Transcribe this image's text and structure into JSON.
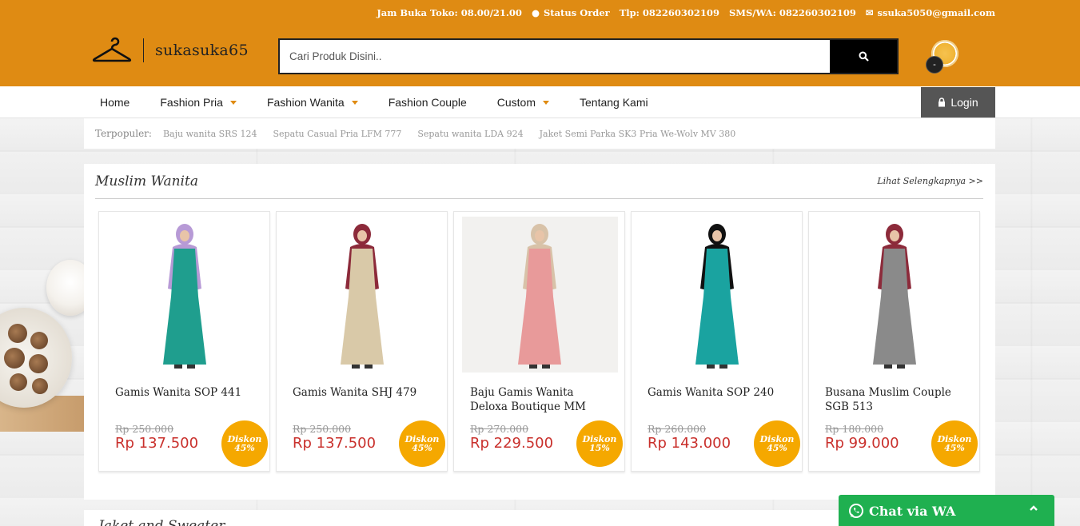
{
  "topbar": {
    "hours": "Jam Buka Toko: 08.00/21.00",
    "status_order": "Status Order",
    "phone": "Tlp: 082260302109",
    "sms_wa": "SMS/WA: 082260302109",
    "email": "ssuka5050@gmail.com"
  },
  "logo": {
    "text": "sukasuka65"
  },
  "search": {
    "placeholder": "Cari Produk Disini.."
  },
  "cart": {
    "count": "-"
  },
  "nav": {
    "items": [
      {
        "label": "Home",
        "dropdown": false
      },
      {
        "label": "Fashion Pria",
        "dropdown": true
      },
      {
        "label": "Fashion Wanita",
        "dropdown": true
      },
      {
        "label": "Fashion Couple",
        "dropdown": false
      },
      {
        "label": "Custom",
        "dropdown": true
      },
      {
        "label": "Tentang Kami",
        "dropdown": false
      }
    ],
    "login": "Login"
  },
  "popular": {
    "label": "Terpopuler:",
    "items": [
      "Baju wanita SRS 124",
      "Sepatu Casual Pria LFM 777",
      "Sepatu wanita LDA 924",
      "Jaket Semi Parka SK3 Pria We-Wolv MV 380"
    ]
  },
  "section": {
    "title": "Muslim Wanita",
    "more": "Lihat Selengkapnya >>",
    "products": [
      {
        "name": "Gamis Wanita SOP 441",
        "old_price": "Rp 250.000",
        "price": "Rp 137.500",
        "disc_label": "Diskon",
        "disc": "45%",
        "colors": {
          "main": "#1f9e8e",
          "accent": "#b79ad6"
        }
      },
      {
        "name": "Gamis Wanita SHJ 479",
        "old_price": "Rp 250.000",
        "price": "Rp 137.500",
        "disc_label": "Diskon",
        "disc": "45%",
        "colors": {
          "main": "#d9c9a8",
          "accent": "#8c2a3a"
        }
      },
      {
        "name": "Baju Gamis Wanita Deloxa Boutique MM",
        "old_price": "Rp 270.000",
        "price": "Rp 229.500",
        "disc_label": "Diskon",
        "disc": "15%",
        "colors": {
          "main": "#e89a9a",
          "accent": "#d8c2a8"
        }
      },
      {
        "name": "Gamis Wanita SOP 240",
        "old_price": "Rp 260.000",
        "price": "Rp 143.000",
        "disc_label": "Diskon",
        "disc": "45%",
        "colors": {
          "main": "#1aa3a0",
          "accent": "#111111"
        }
      },
      {
        "name": "Busana Muslim Couple SGB 513",
        "old_price": "Rp 180.000",
        "price": "Rp 99.000",
        "disc_label": "Diskon",
        "disc": "45%",
        "colors": {
          "main": "#8a8a8a",
          "accent": "#8c2a3a"
        }
      }
    ]
  },
  "section2": {
    "title": "Jaket and Sweater"
  },
  "whatsapp": {
    "label": "Chat via WA"
  }
}
